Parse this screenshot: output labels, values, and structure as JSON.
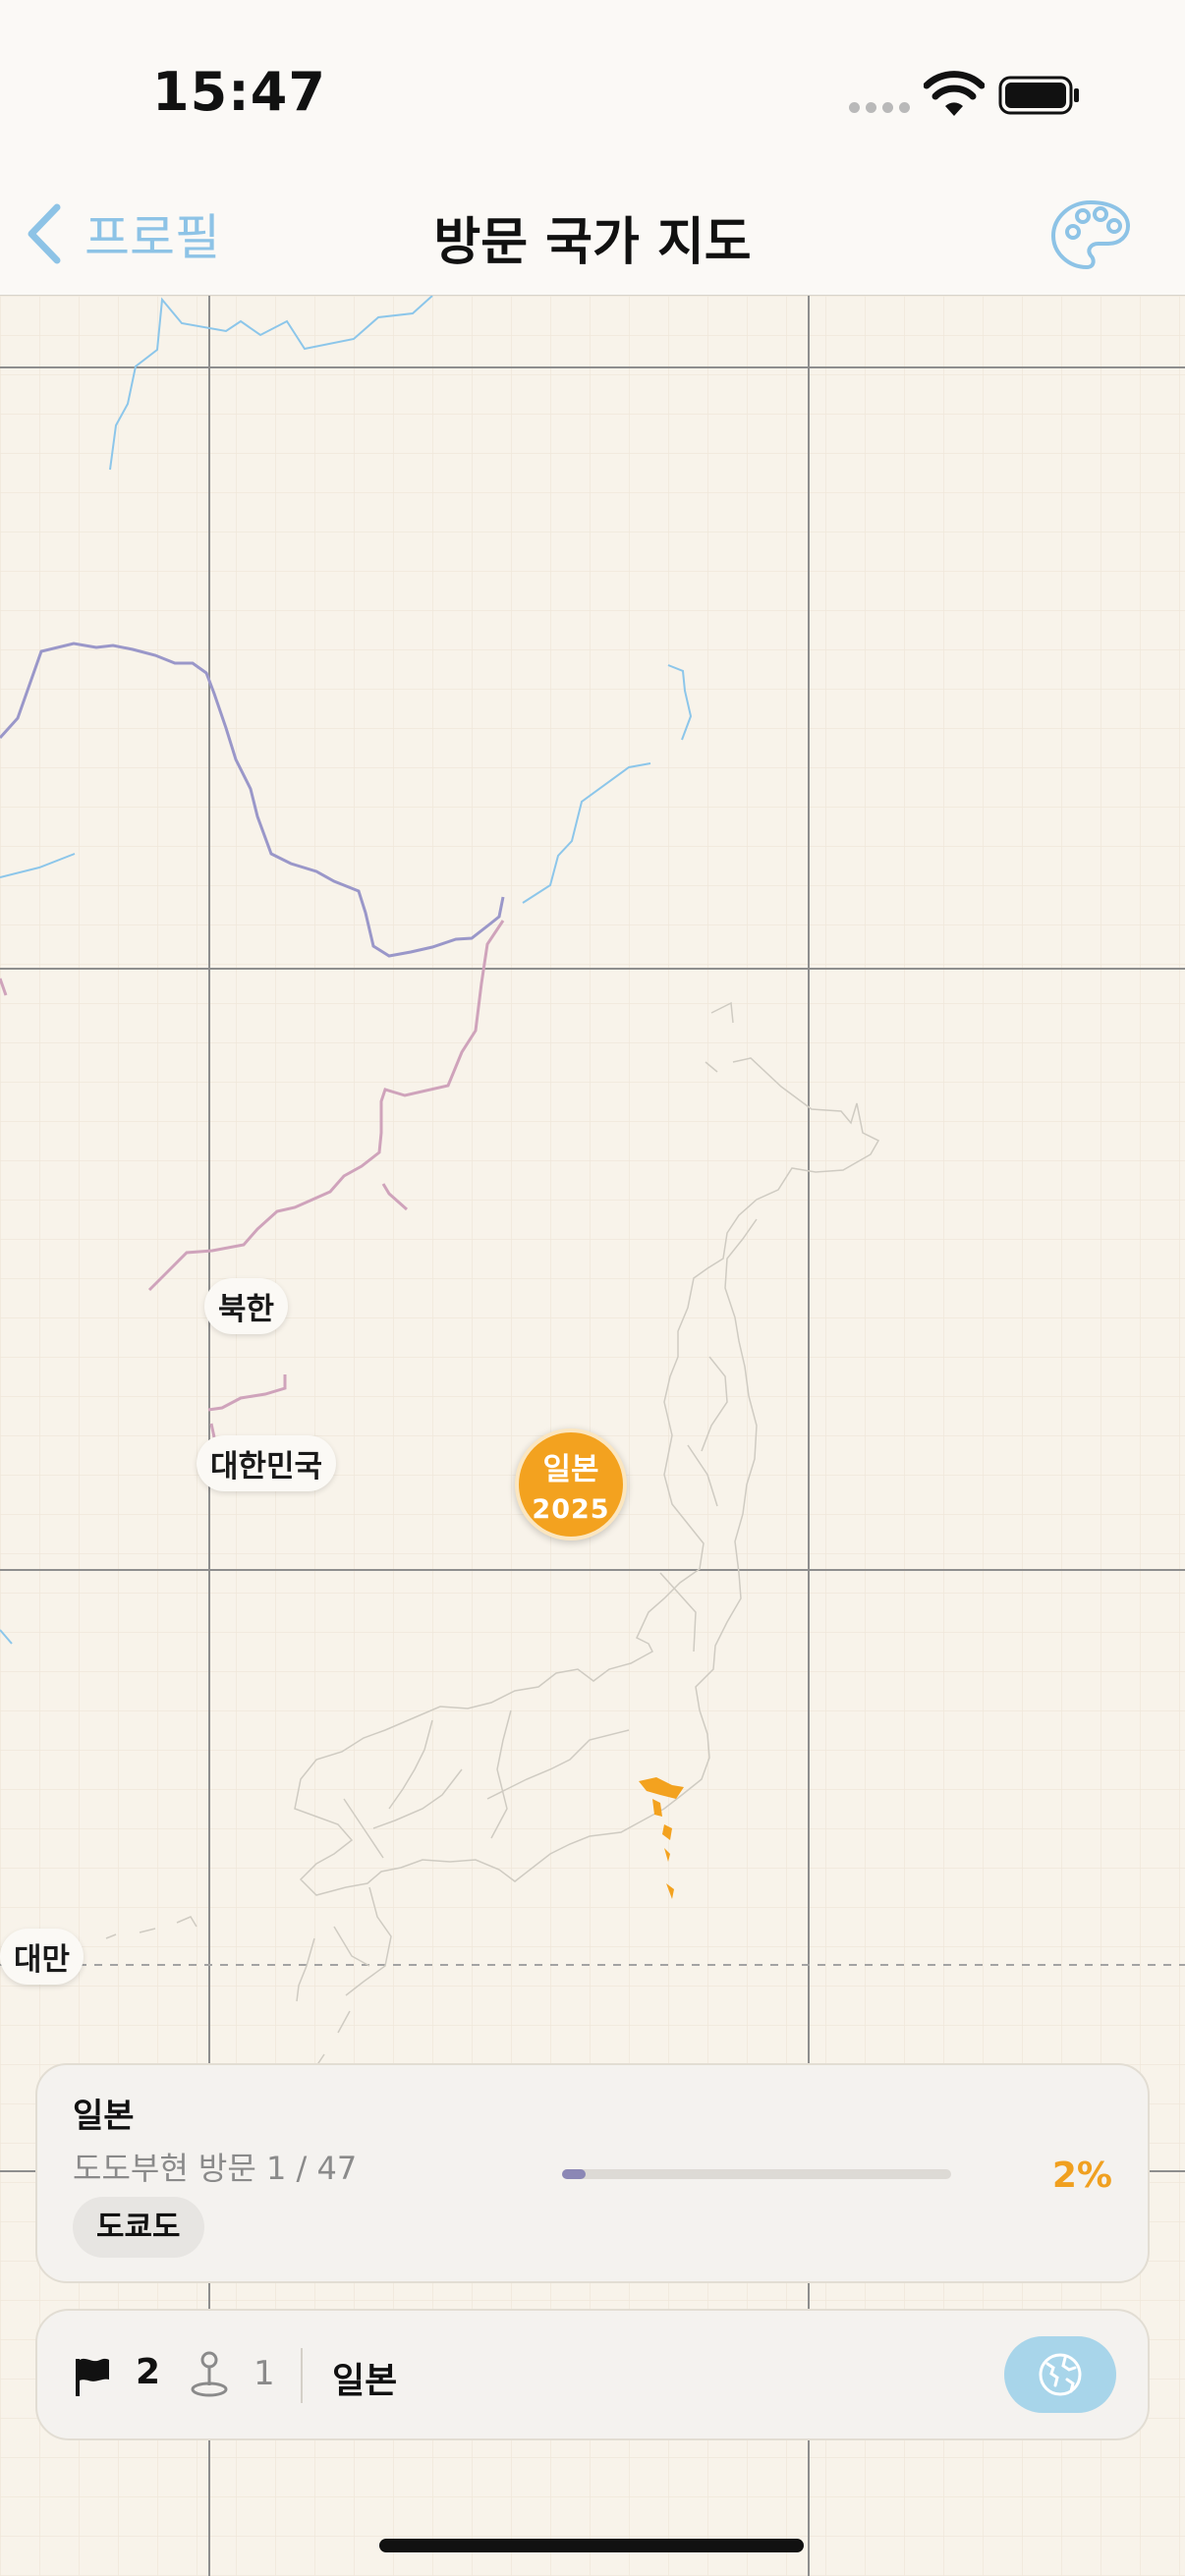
{
  "status_bar": {
    "time": "15:47"
  },
  "nav": {
    "back_label": "프로필",
    "title": "방문 국가 지도"
  },
  "map": {
    "labels": {
      "north_korea": "북한",
      "south_korea": "대한민국",
      "taiwan": "대만"
    },
    "pin": {
      "country": "일본",
      "year": "2025"
    },
    "colors": {
      "visited": "#f3a21f",
      "background": "#f8f3ea"
    }
  },
  "card": {
    "country": "일본",
    "visits_text": "도도부현 방문 1 / 47",
    "progress": 0.02,
    "percent": "2%",
    "chip": "도쿄도"
  },
  "bottom_bar": {
    "flag_count": "2",
    "pin_count": "1",
    "current_country": "일본"
  },
  "icons": [
    "chevron-left-icon",
    "palette-icon",
    "flag-icon",
    "map-pin-icon",
    "globe-icon"
  ]
}
